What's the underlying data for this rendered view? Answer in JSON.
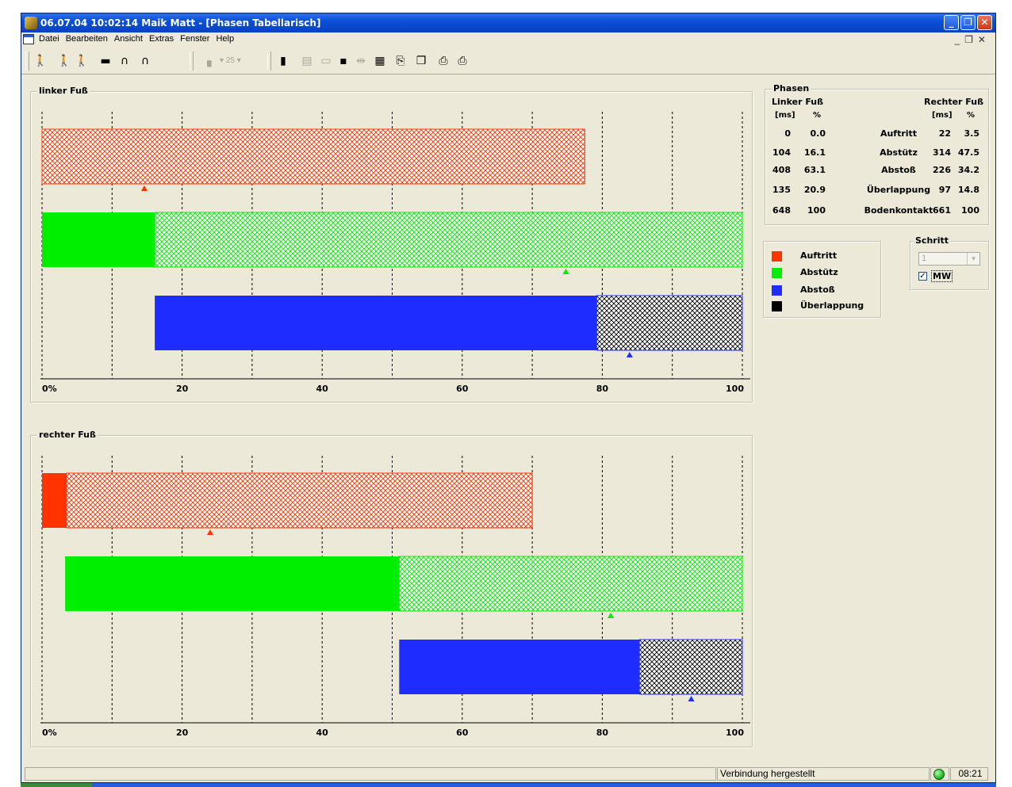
{
  "window": {
    "title": "06.07.04 10:02:14 Maik Matt  - [Phasen Tabellarisch]"
  },
  "menu": [
    "Datei",
    "Bearbeiten",
    "Ansicht",
    "Extras",
    "Fenster",
    "Help"
  ],
  "toolbar": {
    "zoom_value": "25",
    "icons": [
      "walk-icon",
      "walk-pair-icon",
      "walk-compare-icon",
      "color-bars-icon",
      "curves-icon",
      "curves-alt-icon",
      "foot-icon",
      "bars-person-icon",
      "open-icon",
      "folder-icon",
      "save-icon",
      "separator-icon",
      "barcode-icon",
      "preview-icon",
      "copy-icon",
      "print-icon",
      "print-setup-icon"
    ]
  },
  "panels": {
    "left": {
      "title": "linker Fuß"
    },
    "right": {
      "title": "rechter Fuß"
    }
  },
  "chart_data": [
    {
      "type": "bar",
      "title": "linker Fuß",
      "xlim": [
        0,
        100
      ],
      "tick_labels": [
        "0%",
        "20",
        "40",
        "60",
        "80",
        "100"
      ],
      "grid": true,
      "bars": [
        {
          "name": "Auftritt",
          "solid": [
            0,
            0
          ],
          "hatched": [
            0,
            77.5
          ],
          "marker": 14.6,
          "color": "#ff3300"
        },
        {
          "name": "Abstütz",
          "solid": [
            0,
            16.1
          ],
          "hatched": [
            16.1,
            100
          ],
          "marker": 74.8,
          "color": "#00ee00"
        },
        {
          "name": "Abstoß",
          "solid": [
            16.1,
            79.2
          ],
          "hatched": [
            79.2,
            100
          ],
          "marker": 83.9,
          "color": "#1f2cff"
        }
      ]
    },
    {
      "type": "bar",
      "title": "rechter Fuß",
      "xlim": [
        0,
        100
      ],
      "tick_labels": [
        "0%",
        "20",
        "40",
        "60",
        "80",
        "100"
      ],
      "grid": true,
      "bars": [
        {
          "name": "Auftritt",
          "solid": [
            0,
            3.5
          ],
          "hatched": [
            3.5,
            70
          ],
          "marker": 24.0,
          "color": "#ff3300"
        },
        {
          "name": "Abstütz",
          "solid": [
            3.3,
            51.0
          ],
          "hatched": [
            51.0,
            100
          ],
          "marker": 81.2,
          "color": "#00ee00"
        },
        {
          "name": "Abstoß",
          "solid": [
            51.0,
            85.3
          ],
          "hatched": [
            85.3,
            100
          ],
          "marker": 92.7,
          "color": "#1f2cff"
        }
      ]
    }
  ],
  "phasen": {
    "title": "Phasen",
    "left_head": "Linker Fuß",
    "right_head": "Rechter Fuß",
    "units": {
      "ms": "[ms]",
      "pct": "%"
    },
    "rows": [
      {
        "lms": "0",
        "lpct": "0.0",
        "label": "Auftritt",
        "rms": "22",
        "rpct": "3.5"
      },
      {
        "lms": "104",
        "lpct": "16.1",
        "label": "Abstütz",
        "rms": "314",
        "rpct": "47.5"
      },
      {
        "lms": "408",
        "lpct": "63.1",
        "label": "Abstoß",
        "rms": "226",
        "rpct": "34.2"
      },
      {
        "lms": "135",
        "lpct": "20.9",
        "label": "Überlappung",
        "rms": "97",
        "rpct": "14.8"
      },
      {
        "lms": "648",
        "lpct": "100",
        "label": "Bodenkontakt",
        "rms": "661",
        "rpct": "100"
      }
    ]
  },
  "legend": [
    {
      "label": "Auftritt",
      "color": "#ff3300"
    },
    {
      "label": "Abstütz",
      "color": "#00ee00"
    },
    {
      "label": "Abstoß",
      "color": "#1f2cff"
    },
    {
      "label": "Überlappung",
      "color": "#000000"
    }
  ],
  "schritt": {
    "title": "Schritt",
    "select_value": "1",
    "mw_label": "MW",
    "mw_checked": true
  },
  "status": {
    "connection": "Verbindung hergestellt",
    "time": "08:21",
    "indicator_color": "#22c022"
  }
}
